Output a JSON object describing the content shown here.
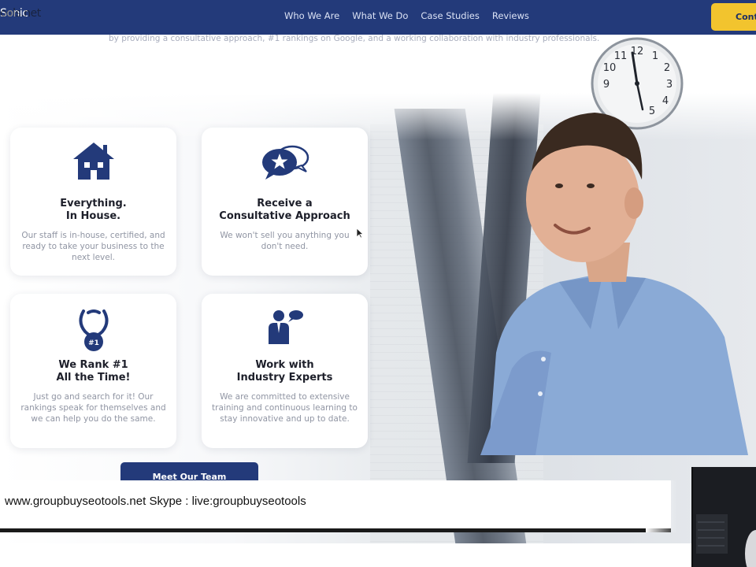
{
  "nav": {
    "logo": "Sonic",
    "logo_overlay": "ools.net",
    "links": [
      "Who We Are",
      "What We Do",
      "Case Studies",
      "Reviews"
    ],
    "cta_label": "Cont"
  },
  "intro_text": "by providing a consultative approach, #1 rankings on Google, and a working collaboration with industry professionals.",
  "cards": [
    {
      "icon": "house-icon",
      "title_line1": "Everything.",
      "title_line2": "In House.",
      "body": "Our staff is in-house, certified, and ready to take your business to the next level."
    },
    {
      "icon": "chat-bubble-star-icon",
      "title_line1": "Receive a",
      "title_line2": "Consultative Approach",
      "body": "We won't sell you anything you don't need."
    },
    {
      "icon": "rank-medal-icon",
      "title_line1": "We Rank #1",
      "title_line2": "All the Time!",
      "body": "Just go and search for it! Our rankings speak for themselves and we can help you do the same.",
      "badge": "#1"
    },
    {
      "icon": "expert-person-icon",
      "title_line1": "Work with",
      "title_line2": "Industry Experts",
      "body": "We are committed to extensive training and continuous learning to stay innovative and up to date."
    }
  ],
  "meet_button": "Meet Our Team",
  "banner_text": "www.groupbuyseotools.net Skype : live:groupbuyseotools",
  "colors": {
    "navy": "#233a7a",
    "accent_yellow": "#f2c42e",
    "card_bg": "#ffffff"
  }
}
